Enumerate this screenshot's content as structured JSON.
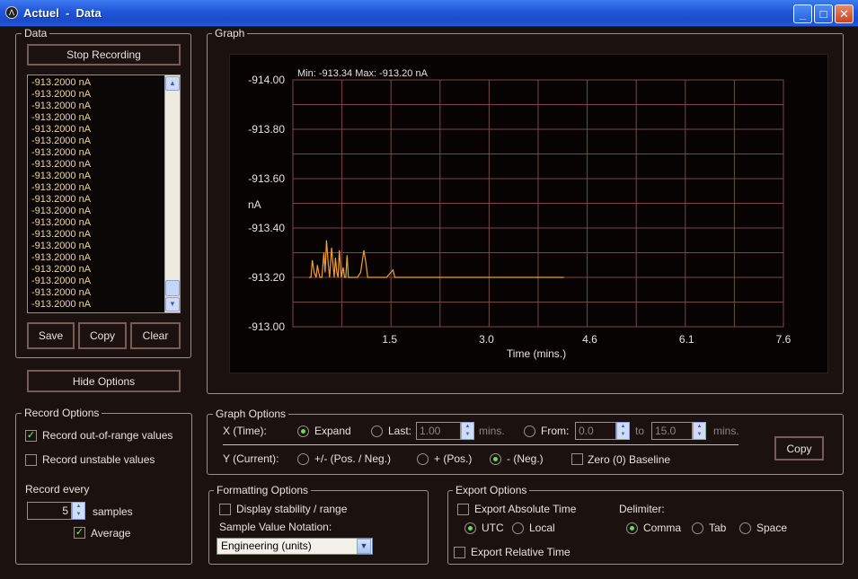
{
  "window": {
    "title": "Actuel  -  Data",
    "minimize_glyph": "_",
    "maximize_glyph": "□",
    "close_glyph": "✕",
    "icon": "app-logo-icon"
  },
  "data_panel": {
    "legend": "Data",
    "stop_button": "Stop Recording",
    "readings": [
      "-913.2000 nA",
      "-913.2000 nA",
      "-913.2000 nA",
      "-913.2000 nA",
      "-913.2000 nA",
      "-913.2000 nA",
      "-913.2000 nA",
      "-913.2000 nA",
      "-913.2000 nA",
      "-913.2000 nA",
      "-913.2000 nA",
      "-913.2000 nA",
      "-913.2000 nA",
      "-913.2000 nA",
      "-913.2000 nA",
      "-913.2000 nA",
      "-913.2000 nA",
      "-913.2000 nA",
      "-913.2000 nA",
      "-913.2000 nA"
    ],
    "save_button": "Save",
    "copy_button": "Copy",
    "clear_button": "Clear",
    "hide_options_button": "Hide Options"
  },
  "record_options": {
    "legend": "Record Options",
    "out_of_range_label": "Record out-of-range values",
    "out_of_range_checked": true,
    "unstable_label": "Record unstable values",
    "unstable_checked": false,
    "record_every_label": "Record every",
    "every_value": "5",
    "samples_label": "samples",
    "average_label": "Average",
    "average_checked": true
  },
  "graph": {
    "legend": "Graph",
    "stats": "Min: -913.34    Max: -913.20 nA"
  },
  "chart_data": {
    "type": "line",
    "title": "",
    "xlabel": "Time (mins.)",
    "ylabel": "nA",
    "xlim": [
      0,
      7.6
    ],
    "ylim": [
      -914.0,
      -913.0
    ],
    "x_ticks": [
      "1.5",
      "3.0",
      "4.6",
      "6.1",
      "7.6"
    ],
    "y_ticks": [
      "-914.00",
      "-913.80",
      "-913.60",
      "-913.40",
      "-913.20",
      "-913.00"
    ],
    "y_reversed": true,
    "grid": true,
    "series": [
      {
        "color": "#f0a030",
        "x": [
          0.25,
          0.28,
          0.3,
          0.33,
          0.36,
          0.38,
          0.4,
          0.42,
          0.45,
          0.48,
          0.5,
          0.52,
          0.55,
          0.57,
          0.6,
          0.62,
          0.64,
          0.66,
          0.68,
          0.7,
          0.72,
          0.75,
          0.78,
          0.8,
          0.82,
          0.84,
          0.86,
          0.9,
          0.95,
          1.0,
          1.05,
          1.1,
          1.13,
          1.16,
          1.2,
          1.25,
          1.35,
          1.45,
          1.55,
          1.58,
          1.62,
          1.7,
          2.0,
          2.5,
          3.0,
          3.5,
          4.0,
          4.2
        ],
        "y": [
          -913.2,
          -913.2,
          -913.27,
          -913.22,
          -913.2,
          -913.25,
          -913.22,
          -913.2,
          -913.2,
          -913.3,
          -913.22,
          -913.35,
          -913.25,
          -913.2,
          -913.32,
          -913.26,
          -913.2,
          -913.28,
          -913.22,
          -913.2,
          -913.31,
          -913.2,
          -913.24,
          -913.2,
          -913.2,
          -913.29,
          -913.2,
          -913.2,
          -913.2,
          -913.2,
          -913.22,
          -913.31,
          -913.26,
          -913.2,
          -913.2,
          -913.2,
          -913.2,
          -913.2,
          -913.23,
          -913.2,
          -913.2,
          -913.2,
          -913.2,
          -913.2,
          -913.2,
          -913.2,
          -913.2,
          -913.2
        ]
      }
    ]
  },
  "graph_options": {
    "legend": "Graph Options",
    "x_label": "X (Time):",
    "expand_label": "Expand",
    "expand_selected": true,
    "last_label": "Last:",
    "last_value": "1.00",
    "last_unit": "mins.",
    "from_label": "From:",
    "from_value": "0.0",
    "to_label": "to",
    "to_value": "15.0",
    "to_unit": "mins.",
    "y_label": "Y (Current):",
    "posneg_label": "+/- (Pos. / Neg.)",
    "pos_label": "+ (Pos.)",
    "neg_label": "- (Neg.)",
    "neg_selected": true,
    "zero_baseline_label": "Zero (0) Baseline",
    "copy_button": "Copy"
  },
  "formatting_options": {
    "legend": "Formatting Options",
    "display_stability_label": "Display stability / range",
    "notation_label": "Sample Value Notation:",
    "notation_value": "Engineering (units)"
  },
  "export_options": {
    "legend": "Export Options",
    "abs_time_label": "Export Absolute Time",
    "utc_label": "UTC",
    "utc_selected": true,
    "local_label": "Local",
    "delimiter_label": "Delimiter:",
    "comma_label": "Comma",
    "comma_selected": true,
    "tab_label": "Tab",
    "space_label": "Space",
    "rel_time_label": "Export Relative Time"
  }
}
